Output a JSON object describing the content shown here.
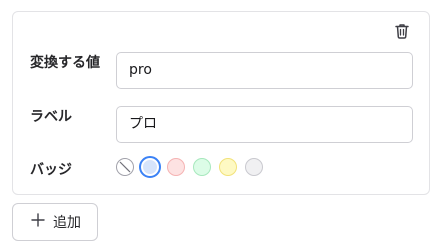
{
  "item": {
    "value_label": "変換する値",
    "value": "pro",
    "label_label": "ラベル",
    "label_value": "プロ",
    "badge_label": "バッジ",
    "badges": [
      {
        "name": "none",
        "color": "#ffffff",
        "border": "#a1a1aa"
      },
      {
        "name": "blue",
        "color": "#d6e4fb",
        "border": "#3b82f6",
        "selected": true
      },
      {
        "name": "red",
        "color": "#fde2e2",
        "border": "#f5b3b3"
      },
      {
        "name": "green",
        "color": "#dcfce7",
        "border": "#a7e8bd"
      },
      {
        "name": "yellow",
        "color": "#fef9c3",
        "border": "#f2e27a"
      },
      {
        "name": "gray",
        "color": "#f0f0f2",
        "border": "#c9c9cf"
      }
    ],
    "delete_icon": "trash-icon"
  },
  "add_button": {
    "icon": "plus-icon",
    "label": "追加"
  }
}
